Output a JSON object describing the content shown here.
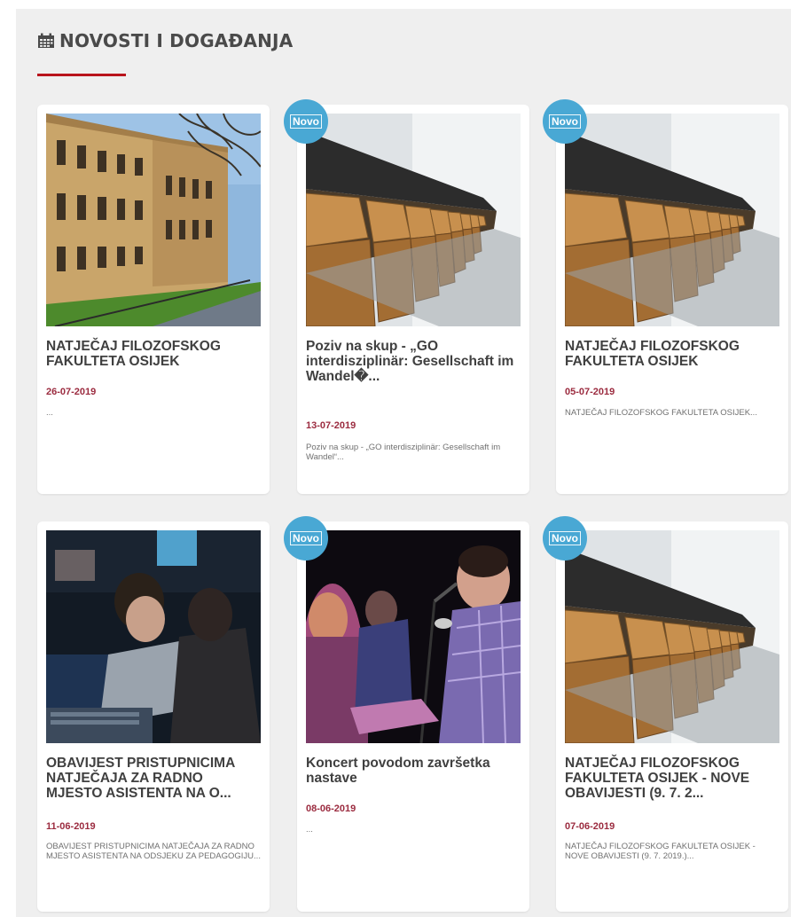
{
  "section": {
    "title": "NOVOSTI I DOGAĐANJA",
    "icon": "calendar-icon",
    "accent_color": "#b9141c"
  },
  "badge_label": "Novo",
  "badge_color": "#49a8d4",
  "cards": [
    {
      "title": "NATJEČAJ FILOZOFSKOG FAKULTETA OSIJEK",
      "date": "26-07-2019",
      "excerpt": "...",
      "is_new": false,
      "image": "university-building"
    },
    {
      "title": "Poziv na skup - „GO interdisziplinär: Gesellschaft im Wandel�...",
      "date": "13-07-2019",
      "excerpt": "Poziv na skup - „GO interdisziplinär: Gesellschaft im Wandel“...",
      "is_new": true,
      "image": "lecture-hall-seats"
    },
    {
      "title": "NATJEČAJ FILOZOFSKOG FAKULTETA OSIJEK",
      "date": "05-07-2019",
      "excerpt": "NATJEČAJ FILOZOFSKOG FAKULTETA OSIJEK...",
      "is_new": true,
      "image": "lecture-hall-seats"
    },
    {
      "title": "OBAVIJEST PRISTUPNICIMA NATJEČAJA ZA RADNO MJESTO ASISTENTA NA O...",
      "date": "11-06-2019",
      "excerpt": "OBAVIJEST PRISTUPNICIMA NATJEČAJA ZA RADNO MJESTO ASISTENTA NA ODSJEKU ZA PEDAGOGIJU...",
      "is_new": false,
      "image": "students-at-computer"
    },
    {
      "title": "Koncert povodom završetka nastave",
      "date": "08-06-2019",
      "excerpt": "...",
      "is_new": true,
      "image": "concert-singer"
    },
    {
      "title": "NATJEČAJ FILOZOFSKOG FAKULTETA OSIJEK - NOVE OBAVIJESTI (9. 7. 2...",
      "date": "07-06-2019",
      "excerpt": "NATJEČAJ FILOZOFSKOG FAKULTETA OSIJEK - NOVE OBAVIJESTI (9. 7. 2019.)...",
      "is_new": true,
      "image": "lecture-hall-seats"
    }
  ]
}
